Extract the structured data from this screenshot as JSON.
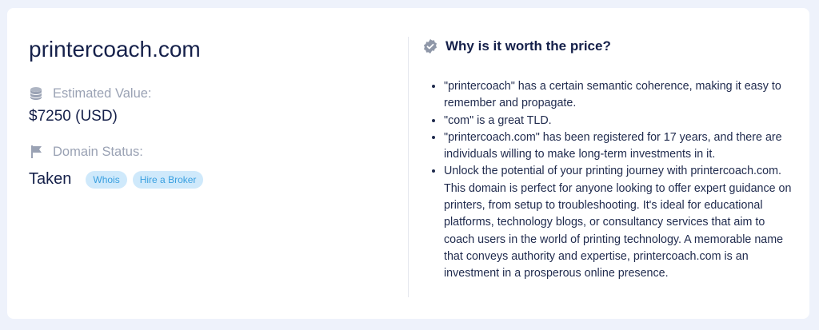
{
  "domain": {
    "name": "printercoach.com"
  },
  "estimated_value": {
    "label": "Estimated Value:",
    "value": "$7250 (USD)",
    "icon": "coins-icon"
  },
  "domain_status": {
    "label": "Domain Status:",
    "value": "Taken",
    "icon": "flag-icon",
    "buttons": {
      "whois": "Whois",
      "broker": "Hire a Broker"
    }
  },
  "worth": {
    "title": "Why is it worth the price?",
    "icon": "verified-badge-icon",
    "reasons": [
      "\"printercoach\" has a certain semantic coherence, making it easy to remember and propagate.",
      "\"com\" is a great TLD.",
      "\"printercoach.com\" has been registered for 17 years, and there are individuals willing to make long-term investments in it.",
      "Unlock the potential of your printing journey with printercoach.com. This domain is perfect for anyone looking to offer expert guidance on printers, from setup to troubleshooting. It's ideal for educational platforms, technology blogs, or consultancy services that aim to coach users in the world of printing technology. A memorable name that conveys authority and expertise, printercoach.com is an investment in a prosperous online presence."
    ]
  },
  "colors": {
    "background": "#eef2fb",
    "card": "#ffffff",
    "text_primary": "#15204a",
    "text_muted": "#9aa2b4",
    "pill_bg": "#cfe9fb",
    "pill_text": "#3aa0e0"
  }
}
